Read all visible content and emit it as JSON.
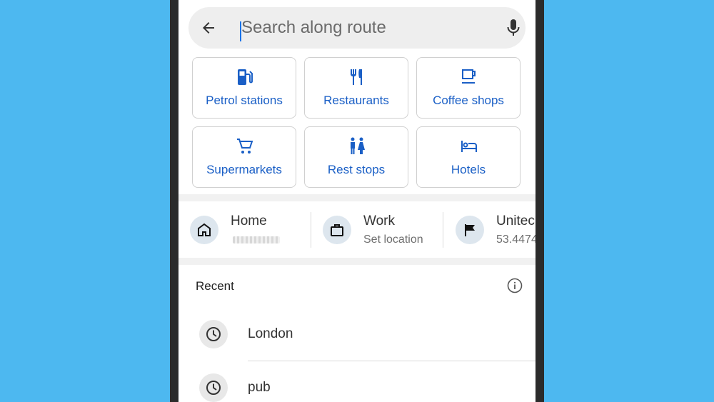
{
  "search": {
    "placeholder": "Search along route"
  },
  "categories": [
    {
      "label": "Petrol stations",
      "icon": "gas-station-icon"
    },
    {
      "label": "Restaurants",
      "icon": "fork-knife-icon"
    },
    {
      "label": "Coffee shops",
      "icon": "coffee-cup-icon"
    },
    {
      "label": "Supermarkets",
      "icon": "shopping-cart-icon"
    },
    {
      "label": "Rest stops",
      "icon": "restroom-icon"
    },
    {
      "label": "Hotels",
      "icon": "bed-icon"
    }
  ],
  "shortcuts": [
    {
      "title": "Home",
      "subtitle": "",
      "icon": "home-icon"
    },
    {
      "title": "Work",
      "subtitle": "Set location",
      "icon": "briefcase-icon"
    },
    {
      "title": "Unitec",
      "subtitle": "53.4474",
      "icon": "flag-icon"
    }
  ],
  "recent": {
    "heading": "Recent",
    "items": [
      {
        "label": "London",
        "icon": "clock-icon"
      },
      {
        "label": "pub",
        "icon": "clock-icon"
      }
    ]
  },
  "colors": {
    "background": "#4db8f0",
    "accent": "#1a5fc6",
    "cursor": "#1a73e8"
  }
}
